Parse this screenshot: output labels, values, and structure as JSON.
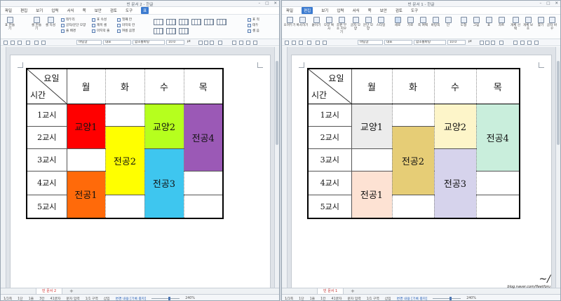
{
  "windows": [
    {
      "title": "빈 문서 2 - 한글",
      "menus": [
        "파일",
        "편집",
        "보기",
        "입력",
        "서식",
        "쪽",
        "보안",
        "검토",
        "도구",
        "표"
      ],
      "active_menu": "표",
      "ribbon_left": [
        "표 만들기",
        "셀 만들기",
        "셀 속성"
      ],
      "ribbon_checks": [
        "테두리",
        "글자/문단 모양",
        "줄 배경",
        "표 속성",
        "제목 셀",
        "마지막 줄",
        "첫째 칸",
        "마지막 칸",
        "여름 음영"
      ],
      "ribbon_right": [
        "표 적",
        "테두",
        "셀 음"
      ],
      "toolbar": {
        "style": "바탕글",
        "font": "대표",
        "font_face": "함초롬바탕",
        "size": "10.0",
        "unit": "pt"
      },
      "tab_label": "빈 문서 2",
      "status": [
        "1/1쪽",
        "1단",
        "1줄",
        "3칸",
        "41글자",
        "문자 입력",
        "1/1 구역",
        "삽입",
        "변경 내용 [기록 중지]",
        "240%"
      ]
    },
    {
      "title": "빈 문서 1 - 한글",
      "menus": [
        "파일",
        "편집",
        "보기",
        "입력",
        "서식",
        "쪽",
        "보안",
        "검토",
        "도구"
      ],
      "active_menu": "편집",
      "ribbon_left": [
        "오려두기",
        "복사하기",
        "붙이기",
        "모양 복사",
        "조판 부호 지우기",
        "글자 모양",
        "문단 모양",
        "스타일"
      ],
      "ribbon_right": [
        "세로",
        "가로",
        "쪽 여백",
        "바탕쪽",
        "단",
        "도형",
        "그림",
        "표",
        "차트",
        "개체 선택",
        "개체 보호",
        "찾기",
        "글자 바꾸"
      ],
      "toolbar": {
        "style": "바탕글",
        "font": "대표",
        "font_face": "함초롬바탕",
        "size": "10.0",
        "unit": "pt"
      },
      "tab_label": "빈 문서 1",
      "status": [
        "1/1쪽",
        "1단",
        "1줄",
        "1칸",
        "41글자",
        "문자 입력",
        "1/1 구역",
        "삽입",
        "변경 내용 [기록 중지]",
        "240%"
      ]
    }
  ],
  "timetable": {
    "header_day": "요일",
    "header_time": "시간",
    "days": [
      "월",
      "화",
      "수",
      "목"
    ],
    "periods": [
      "1교시",
      "2교시",
      "3교시",
      "4교시",
      "5교시"
    ],
    "cells": {
      "gyoyang1": "교양1",
      "gyoyang2": "교양2",
      "jeongong1": "전공1",
      "jeongong2": "전공2",
      "jeongong3": "전공3",
      "jeongong4": "전공4"
    }
  },
  "colors_left": {
    "gyoyang1": "#ff0000",
    "gyoyang2": "#b6ff1e",
    "jeongong1": "#ff6a0a",
    "jeongong2": "#ffff00",
    "jeongong3": "#3ec6ef",
    "jeongong4": "#9b59b6"
  },
  "colors_right": {
    "gyoyang1": "#ececec",
    "gyoyang2": "#fdf5c9",
    "jeongong1": "#fde2d3",
    "jeongong2": "#e6cd76",
    "jeongong3": "#d6d3ec",
    "jeongong4": "#c9eedc"
  },
  "watermark": {
    "url": "blog.naver.com/fleetforu"
  }
}
